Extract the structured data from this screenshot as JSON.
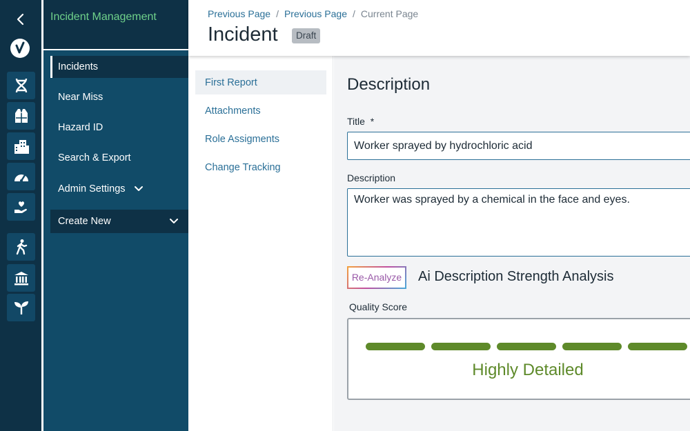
{
  "rail": {
    "icons": [
      "back-chevron-icon",
      "checkmark-logo-icon",
      "dna-icon",
      "safety-vest-icon",
      "buildings-icon",
      "gauge-icon",
      "heart-hand-icon",
      "walking-person-icon",
      "bank-building-icon",
      "sprout-icon"
    ]
  },
  "nav": {
    "title": "Incident Management",
    "items": [
      {
        "label": "Incidents"
      },
      {
        "label": "Near Miss"
      },
      {
        "label": "Hazard ID"
      },
      {
        "label": "Search & Export"
      },
      {
        "label": "Admin Settings"
      }
    ],
    "create_new": "Create New"
  },
  "breadcrumb": {
    "items": [
      "Previous Page",
      "Previous Page",
      "Current Page"
    ],
    "separator": "/"
  },
  "page": {
    "title": "Incident",
    "status_badge": "Draft"
  },
  "tabs": [
    {
      "label": "First Report",
      "active": true
    },
    {
      "label": "Attachments",
      "active": false
    },
    {
      "label": "Role Assigments",
      "active": false
    },
    {
      "label": "Change Tracking",
      "active": false
    }
  ],
  "form": {
    "section_heading": "Description",
    "title_label": "Title",
    "required_mark": "*",
    "title_value": "Worker sprayed by hydrochloric acid",
    "description_label": "Description",
    "description_value": "Worker was sprayed by a chemical in the face and eyes."
  },
  "analysis": {
    "reanalyze_label": "Re-Analyze",
    "title": "Ai Description Strength Analysis",
    "quality_label": "Quality Score",
    "quality_text": "Highly Detailed",
    "score_filled": 5,
    "score_total": 5,
    "score_color": "#5e8a2a"
  },
  "colors": {
    "rail_bg": "#0e3146",
    "nav_bg": "#114b68",
    "accent_green": "#6fd18a",
    "link_blue": "#2a6f97"
  }
}
